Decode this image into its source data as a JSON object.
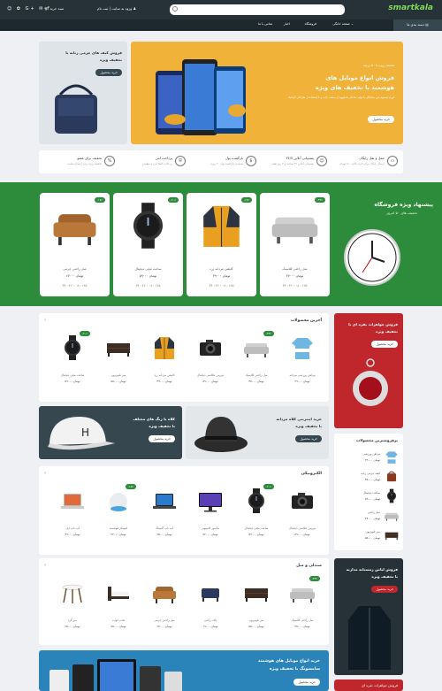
{
  "header": {
    "logo": "smartkala",
    "login": "ورود به سایت | ثبت نام",
    "cart": "سبد خرید",
    "social": "☺ ✿ G+ ✉ f"
  },
  "nav": {
    "all": "دسته بندی ها ▤",
    "items": [
      "صفحه خانگی ⌄",
      "فروشگاه",
      "اخبار",
      "تماس با ما"
    ]
  },
  "hero": {
    "kicker": "تخفیف ویژه تا ۵۰ درصد",
    "title1": "فروش انواع موبایل های",
    "title2": "هوشمند با تخفیف های ویژه",
    "desc": "لورم ایپسوم متن ساختگی با تولید سادگی نامفهوم از صنعت چاپ و با استفاده از طراحان گرافیک",
    "btn": "خرید محصول"
  },
  "bag": {
    "title1": "فروش کیف های چرمی زنانه با",
    "title2": "تخفیف ویژه",
    "btn": "خرید محصول"
  },
  "features": [
    {
      "t1": "حمل و نقل رایگان",
      "t2": "ارسال رایگان برای خرید بالای ۵۰۰ تومان",
      "icon": "truck-icon",
      "g": "▭"
    },
    {
      "t1": "پشتیبانی آنلاین ۲۴/۷",
      "t2": "پشتیبانی آنلاین ۲۴ ساعته و ۷ روز هفته",
      "icon": "support-icon",
      "g": "☺"
    },
    {
      "t1": "بازگشت پول",
      "t2": "ضمانت بازگشت پول ۳۰ روزه",
      "icon": "money-back-icon",
      "g": "$"
    },
    {
      "t1": "پرداخت امن",
      "t2": "پرداخت کاملا امن و مطمئن",
      "icon": "shield-icon",
      "g": "⛨"
    },
    {
      "t1": "تخفیف برای عضو",
      "t2": "تخفیف ویژه برای اعضای سایت",
      "icon": "percent-icon",
      "g": "%"
    }
  ],
  "special": {
    "title": "پیشنهاد ویژه فروشگاه",
    "sub": "تخفیف های ۵۰ امروز",
    "items": [
      {
        "name": "مبل راحتی کلاسیک",
        "price": "۴۷۰۰۰ تومان",
        "timer": "۳۴ : ۴۶ : ۰۸ : ۱۲۵",
        "badge": "-۳۲٪",
        "pic": "sofa"
      },
      {
        "name": "کاپشن مردانه زرد",
        "price": "۳۹۰۰۰ تومان",
        "timer": "۳۴ : ۴۶ : ۰۸ : ۱۲۵",
        "badge": "-۱۵٪",
        "pic": "jacket"
      },
      {
        "name": "ساعت مچی دیجیتال",
        "price": "۵۹۰۰۰ تومان",
        "timer": "۳۴ : ۴۶ : ۰۸ : ۱۲۵",
        "badge": "-۲۰٪",
        "pic": "watch"
      },
      {
        "name": "مبل راحتی چرمی",
        "price": "۶۷۰۰۰ تومان",
        "timer": "۳۴ : ۴۶ : ۰۸ : ۱۲۵",
        "badge": "-۱۸٪",
        "pic": "armchair"
      }
    ]
  },
  "latest": {
    "title": "آخرین محصولات",
    "items": [
      {
        "name": "پیراهن ورزشی مردانه",
        "price": "۲۹۰۰۰ تومان",
        "pic": "shirt",
        "badge": ""
      },
      {
        "name": "مبل راحتی کلاسیک",
        "price": "۴۷۰۰۰ تومان",
        "pic": "sofa",
        "badge": "-۳۳٪"
      },
      {
        "name": "دوربین عکاسی دیجیتال",
        "price": "۸۹۰۰۰ تومان",
        "pic": "camera",
        "badge": ""
      },
      {
        "name": "کاپشن مردانه زرد",
        "price": "۳۹۰۰۰ تومان",
        "pic": "jacket",
        "badge": ""
      },
      {
        "name": "میز تلویزیون",
        "price": "۵۵۰۰۰ تومان",
        "pic": "table",
        "badge": ""
      },
      {
        "name": "ساعت مچی دیجیتال",
        "price": "۵۹۰۰۰ تومان",
        "pic": "watch",
        "badge": "-۲۰٪"
      }
    ]
  },
  "ruby": {
    "title1": "فروش جواهرات نقره ای با",
    "title2": "تخفیف ویژه",
    "btn": "خرید محصول"
  },
  "hat": {
    "title1": "خرید اینترنتی کلاه مردانه",
    "title2": "با تخفیف ویژه",
    "btn": "خرید محصول"
  },
  "cap": {
    "title1": "کلاه با رنگ های مختلف",
    "title2": "با تخفیف ویژه",
    "btn": "خرید محصول"
  },
  "electronics": {
    "title": "الکترونیکی",
    "items": [
      {
        "name": "دوربین عکاسی دیجیتال",
        "price": "۸۹۰۰۰ تومان",
        "pic": "camera",
        "badge": ""
      },
      {
        "name": "ساعت مچی دیجیتال",
        "price": "۵۹۰۰۰ تومان",
        "pic": "watch",
        "badge": "-۲۰٪"
      },
      {
        "name": "مانیتور کامپیوتر",
        "price": "۷۲۰۰۰ تومان",
        "pic": "monitor",
        "badge": ""
      },
      {
        "name": "لپ تاپ گیمینگ",
        "price": "۹۵۰۰۰ تومان",
        "pic": "laptop",
        "badge": ""
      },
      {
        "name": "اسپیکر هوشمند",
        "price": "۲۴۰۰۰ تومان",
        "pic": "speaker",
        "badge": "-۱۵٪"
      },
      {
        "name": "لپ تاپ اپل",
        "price": "۹۹۰۰۰ تومان",
        "pic": "laptop2",
        "badge": ""
      }
    ]
  },
  "furniture": {
    "title": "صندلی و مبل",
    "items": [
      {
        "name": "مبل راحتی کلاسیک",
        "price": "۴۷۰۰۰ تومان",
        "pic": "sofa",
        "badge": "-۳۳٪"
      },
      {
        "name": "میز تلویزیون",
        "price": "۵۵۰۰۰ تومان",
        "pic": "table",
        "badge": ""
      },
      {
        "name": "پاف راحتی",
        "price": "۱۹۰۰۰ تومان",
        "pic": "ottoman",
        "badge": ""
      },
      {
        "name": "مبل راحتی چرمی",
        "price": "۶۷۰۰۰ تومان",
        "pic": "armchair",
        "badge": ""
      },
      {
        "name": "تخت خواب",
        "price": "۸۵۰۰۰ تومان",
        "pic": "bed",
        "badge": ""
      },
      {
        "name": "میز گرد",
        "price": "۲۵۰۰۰ تومان",
        "pic": "stool",
        "badge": ""
      }
    ]
  },
  "bestsellers": {
    "title": "پرفروشترین محصولات",
    "items": [
      {
        "name": "پیراهن ورزشی",
        "price": "۲۹۰۰۰ تومان",
        "pic": "shirt"
      },
      {
        "name": "کیف چرمی زنانه",
        "price": "۳۵۰۰۰ تومان",
        "pic": "bag"
      },
      {
        "name": "ساعت دیجیتال",
        "price": "۵۹۰۰۰ تومان",
        "pic": "watch"
      },
      {
        "name": "مبل راحتی",
        "price": "۴۷۰۰۰ تومان",
        "pic": "sofa"
      },
      {
        "name": "میز تلویزیون",
        "price": "۵۵۰۰۰ تومان",
        "pic": "table"
      }
    ]
  },
  "jacket": {
    "title1": "فروش لباس زمستانه مدارنه",
    "title2": "با تخفیف ویژه",
    "btn": "خرید محصول"
  },
  "phones": {
    "title1": "خرید انواع موبایل های هوشمند",
    "title2": "سامسونگ با تخفیف ویژه",
    "btn": "خرید محصول"
  },
  "bottom_side": {
    "title": "فروش جواهرات نقره ای"
  }
}
